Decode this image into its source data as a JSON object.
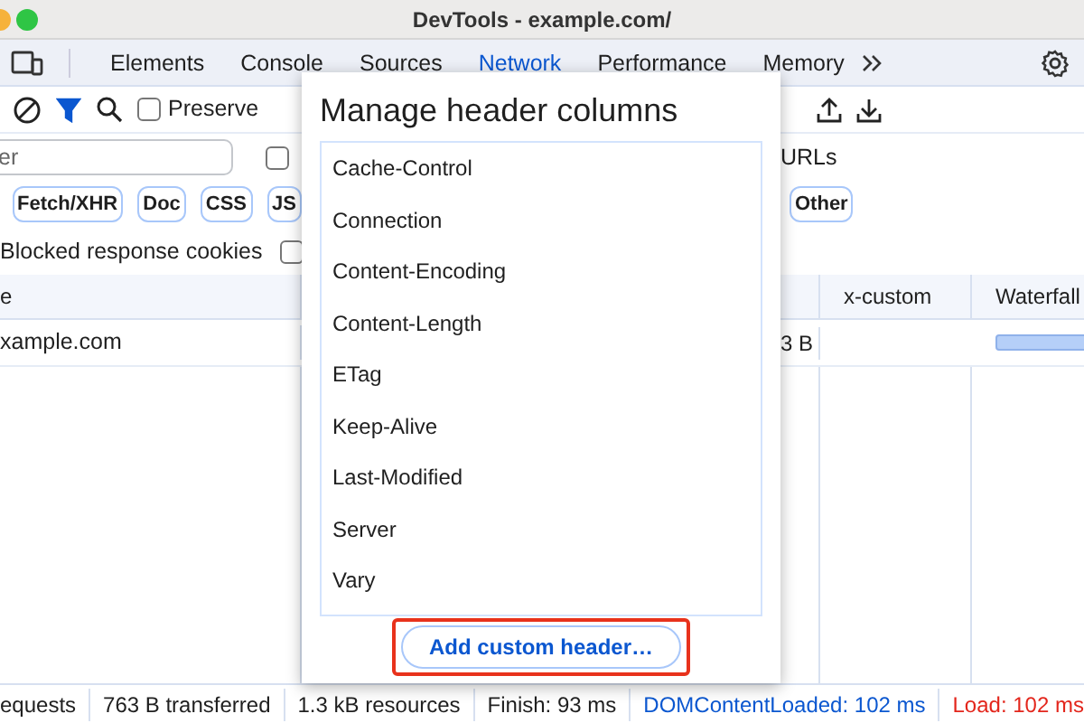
{
  "window": {
    "title": "DevTools - example.com/"
  },
  "tabs": [
    {
      "label": "Elements",
      "selected": false
    },
    {
      "label": "Console",
      "selected": false
    },
    {
      "label": "Sources",
      "selected": false
    },
    {
      "label": "Network",
      "selected": true
    },
    {
      "label": "Performance",
      "selected": false
    },
    {
      "label": "Memory",
      "selected": false
    }
  ],
  "toolbar": {
    "filter_active": true,
    "preserve": {
      "label": "Preserve",
      "checked": false
    }
  },
  "filter": {
    "placeholder": "er",
    "option_checked": false,
    "url_label": "URLs"
  },
  "type_chips_left": [
    {
      "label": "Fetch/XHR"
    },
    {
      "label": "Doc"
    },
    {
      "label": "CSS"
    },
    {
      "label": "JS"
    }
  ],
  "type_chips_right": [
    {
      "label": "Other"
    }
  ],
  "blocked_cookies": {
    "label": "Blocked response cookies",
    "checked": false
  },
  "table": {
    "left_column": "e",
    "right_columns": [
      "x-custom",
      "Waterfall"
    ],
    "rows": [
      {
        "left": "xample.com",
        "size": "3 B"
      }
    ]
  },
  "dialog": {
    "title": "Manage header columns",
    "items": [
      "Cache-Control",
      "Connection",
      "Content-Encoding",
      "Content-Length",
      "ETag",
      "Keep-Alive",
      "Last-Modified",
      "Server",
      "Vary"
    ],
    "button": "Add custom header…",
    "button_highlighted": true
  },
  "status_bar": [
    {
      "text": "equests",
      "kind": "plain"
    },
    {
      "text": "763 B transferred",
      "kind": "plain"
    },
    {
      "text": "1.3 kB resources",
      "kind": "plain"
    },
    {
      "text": "Finish: 93 ms",
      "kind": "plain"
    },
    {
      "text": "DOMContentLoaded: 102 ms",
      "kind": "dom"
    },
    {
      "text": "Load: 102 ms",
      "kind": "load"
    }
  ]
}
